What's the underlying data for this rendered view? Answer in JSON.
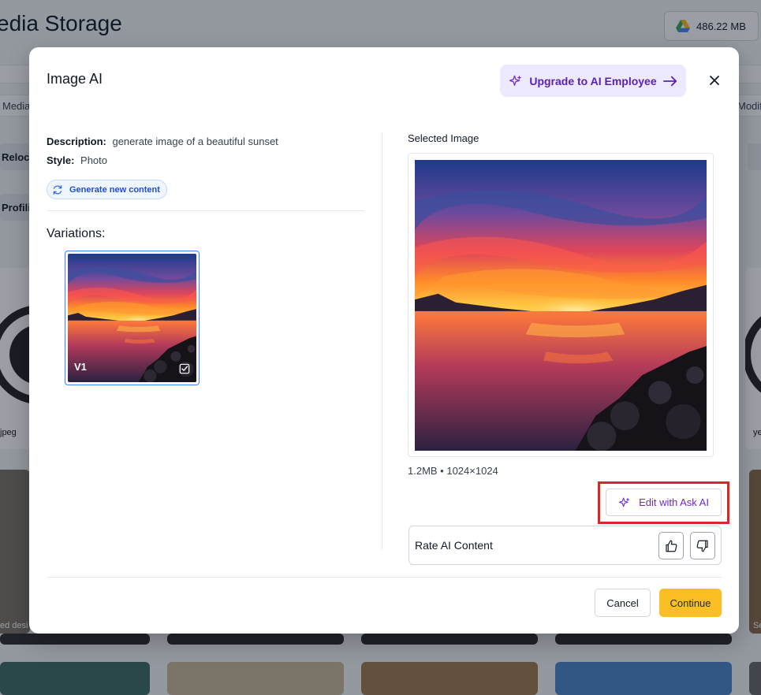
{
  "background": {
    "page_title": "edia Storage",
    "storage": {
      "value": "486.22 MB",
      "icon": "google-drive-icon"
    },
    "tabs": [
      "Media",
      "Modif"
    ],
    "chips": [
      "Reloca",
      "Profili"
    ],
    "captions": [
      "jpeg",
      "ye",
      "ed desi",
      "Se"
    ]
  },
  "modal": {
    "title": "Image AI",
    "upgrade_label": "Upgrade to AI Employee",
    "description_key": "Description:",
    "description_value": "generate image of a beautiful sunset",
    "style_key": "Style:",
    "style_value": "Photo",
    "generate_label": "Generate new content",
    "variations_title": "Variations:",
    "variations": [
      {
        "label": "V1",
        "selected": true
      }
    ],
    "selected_title": "Selected Image",
    "selected_meta": "1.2MB • 1024×1024",
    "edit_label": "Edit with Ask AI",
    "rate_label": "Rate AI Content",
    "cancel_label": "Cancel",
    "continue_label": "Continue"
  },
  "colors": {
    "accent_purple": "#6d28d9",
    "upgrade_bg": "#ede9fe",
    "continue_yellow": "#fbbf24",
    "highlight_red": "#dc2626",
    "selected_border": "#3b82f6"
  }
}
